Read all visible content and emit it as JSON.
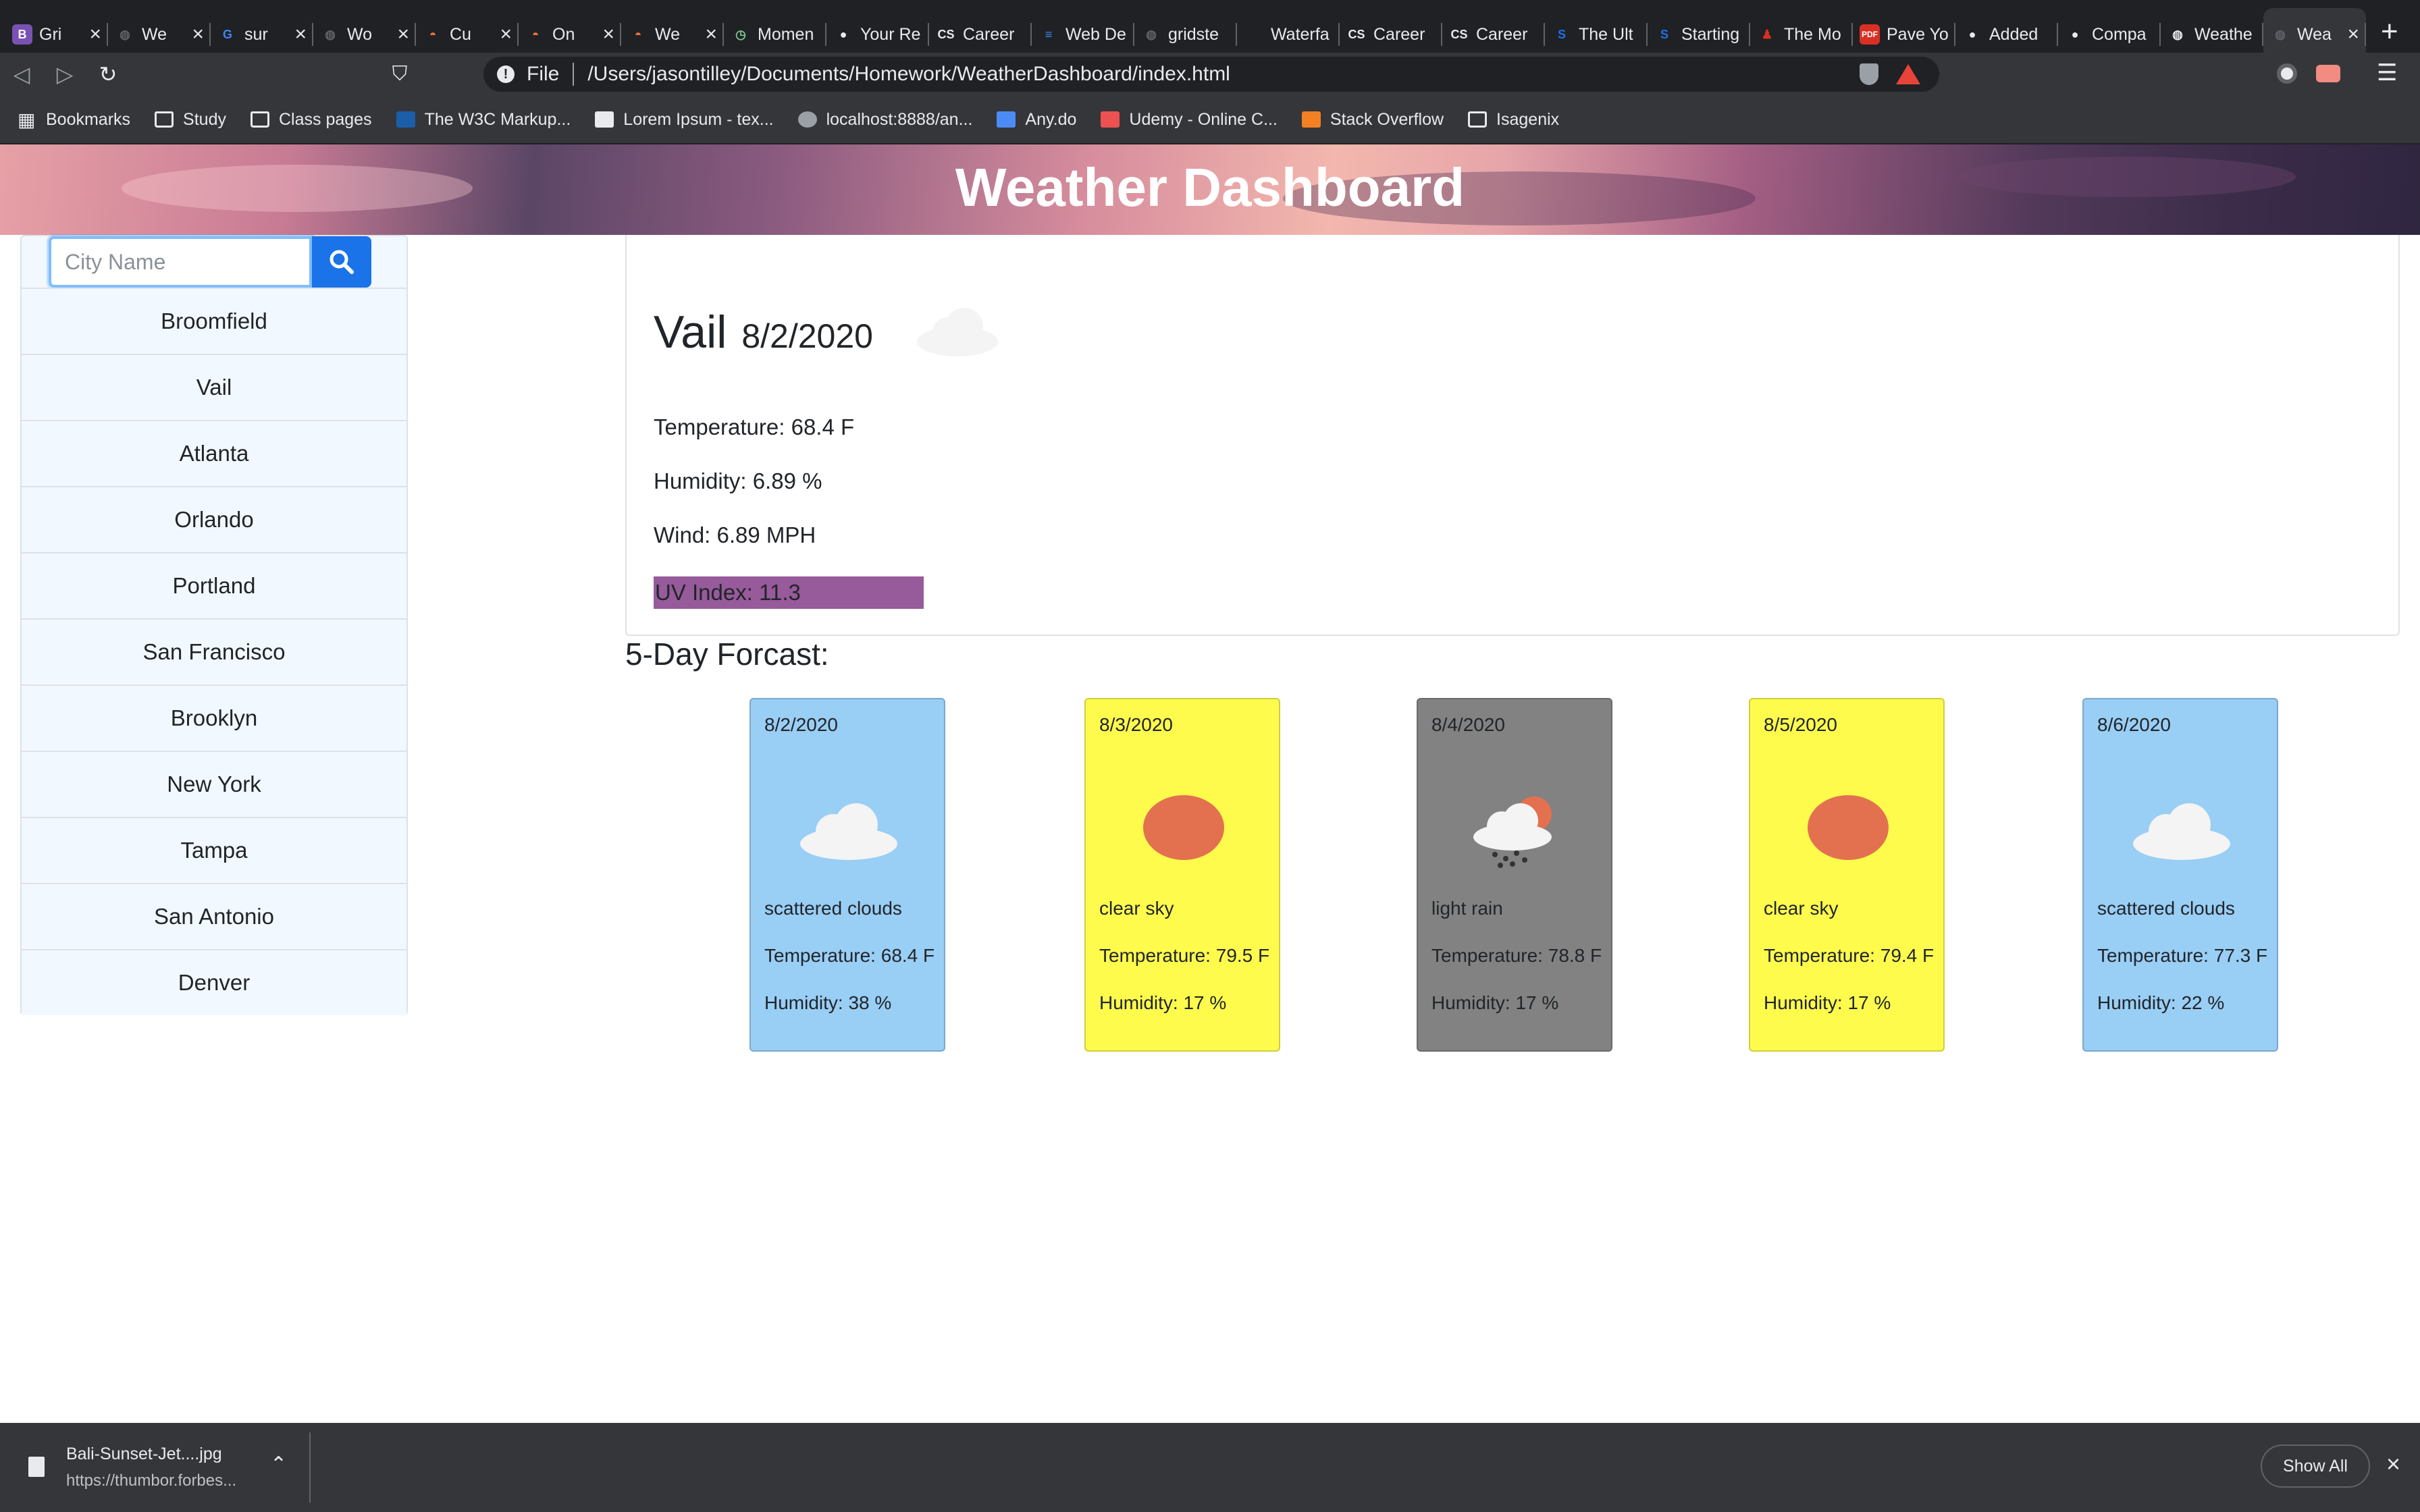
{
  "browser": {
    "tabs": [
      {
        "title": "Gri",
        "icon": "bootstrap",
        "color": "#7952b3"
      },
      {
        "title": "We",
        "icon": "globe",
        "color": "#5f6368"
      },
      {
        "title": "sur",
        "icon": "google",
        "color": "#4285f4"
      },
      {
        "title": "Wo",
        "icon": "globe",
        "color": "#5f6368"
      },
      {
        "title": "Cu",
        "icon": "helmet",
        "color": "#e8713a"
      },
      {
        "title": "On",
        "icon": "helmet",
        "color": "#e8713a"
      },
      {
        "title": "We",
        "icon": "helmet",
        "color": "#e8713a"
      },
      {
        "title": "Momen",
        "icon": "clock",
        "color": "#81c995"
      },
      {
        "title": "Your Re",
        "icon": "github",
        "color": "#e8eaed"
      },
      {
        "title": "Career",
        "icon": "cs",
        "color": "#e8eaed"
      },
      {
        "title": "Web De",
        "icon": "docs",
        "color": "#4285f4"
      },
      {
        "title": "gridste",
        "icon": "globe",
        "color": "#5f6368"
      },
      {
        "title": "Waterfa",
        "icon": "blank",
        "color": "#202124"
      },
      {
        "title": "Career",
        "icon": "cs",
        "color": "#e8eaed"
      },
      {
        "title": "Career",
        "icon": "cs",
        "color": "#e8eaed"
      },
      {
        "title": "The Ult",
        "icon": "s",
        "color": "#1a73e8"
      },
      {
        "title": "Starting",
        "icon": "s",
        "color": "#1a73e8"
      },
      {
        "title": "The Mo",
        "icon": "figure",
        "color": "#d93025"
      },
      {
        "title": "Pave Yo",
        "icon": "pdf",
        "color": "#d93025"
      },
      {
        "title": "Added",
        "icon": "github",
        "color": "#e8eaed"
      },
      {
        "title": "Compa",
        "icon": "github",
        "color": "#e8eaed"
      },
      {
        "title": "Weathe",
        "icon": "globe",
        "color": "#e8eaed"
      },
      {
        "title": "Wea",
        "icon": "globe",
        "color": "#5f6368",
        "active": true
      }
    ],
    "close_glyph": "×",
    "new_tab_glyph": "+",
    "address": {
      "scheme_label": "File",
      "path": "/Users/jasontilley/Documents/Homework/WeatherDashboard/index.html"
    },
    "bookmarks": [
      {
        "label": "Bookmarks",
        "icon": "grid"
      },
      {
        "label": "Study",
        "icon": "folder"
      },
      {
        "label": "Class pages",
        "icon": "folder"
      },
      {
        "label": "The W3C Markup...",
        "icon": "w3c"
      },
      {
        "label": "Lorem Ipsum - tex...",
        "icon": "lorem"
      },
      {
        "label": "localhost:8888/an...",
        "icon": "globe"
      },
      {
        "label": "Any.do",
        "icon": "check"
      },
      {
        "label": "Udemy - Online C...",
        "icon": "udemy"
      },
      {
        "label": "Stack Overflow",
        "icon": "stackoverflow"
      },
      {
        "label": "Isagenix",
        "icon": "folder"
      }
    ]
  },
  "page": {
    "title": "Weather Dashboard",
    "search": {
      "placeholder": "City Name",
      "value": ""
    },
    "cities": [
      "Broomfield",
      "Vail",
      "Atlanta",
      "Orlando",
      "Portland",
      "San Francisco",
      "Brooklyn",
      "New York",
      "Tampa",
      "San Antonio",
      "Denver"
    ],
    "current": {
      "city": "Vail",
      "date": "8/2/2020",
      "icon": "cloud-icon",
      "temperature": "Temperature: 68.4 F",
      "humidity": "Humidity: 6.89 %",
      "wind": "Wind: 6.89 MPH",
      "uv": "UV Index: 11.3",
      "uv_color": "#975a9a"
    },
    "forecast_title": "5-Day Forcast:",
    "forecast": [
      {
        "date": "8/2/2020",
        "icon": "cloud",
        "desc": "scattered clouds",
        "temp": "Temperature: 68.4 F",
        "humidity": "Humidity: 38 %",
        "bg": "#99cef5"
      },
      {
        "date": "8/3/2020",
        "icon": "sun",
        "desc": "clear sky",
        "temp": "Temperature: 79.5 F",
        "humidity": "Humidity: 17 %",
        "bg": "#fffb4d"
      },
      {
        "date": "8/4/2020",
        "icon": "rain",
        "desc": "light rain",
        "temp": "Temperature: 78.8 F",
        "humidity": "Humidity: 17 %",
        "bg": "#828282"
      },
      {
        "date": "8/5/2020",
        "icon": "sun",
        "desc": "clear sky",
        "temp": "Temperature: 79.4 F",
        "humidity": "Humidity: 17 %",
        "bg": "#fffb4d"
      },
      {
        "date": "8/6/2020",
        "icon": "cloud",
        "desc": "scattered clouds",
        "temp": "Temperature: 77.3 F",
        "humidity": "Humidity: 22 %",
        "bg": "#99cef5"
      }
    ]
  },
  "downloads": {
    "file_name": "Bali-Sunset-Jet....jpg",
    "file_url": "https://thumbor.forbes...",
    "show_all": "Show All",
    "close_glyph": "×"
  }
}
